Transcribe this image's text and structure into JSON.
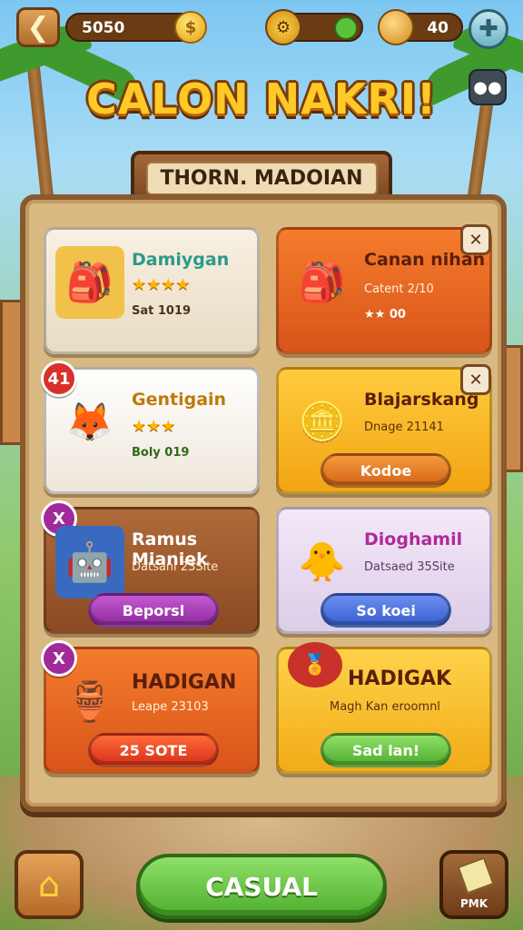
{
  "topbar": {
    "coins": "5050",
    "gems": "40",
    "back_icon": "back-arrow-icon",
    "settings_icon": "settings-gear-icon",
    "chat_icon": "chat-icon"
  },
  "title": "CALON NAKRI!",
  "subtitle": "THORN. MADOIAN",
  "cards": [
    {
      "name": "Damiygan",
      "stars": "★★★★",
      "meta": "Sat 1019",
      "color": "#2a9a8a"
    },
    {
      "name": "Canan nihan",
      "meta": "Catent 2/10",
      "stars": "★★ 00",
      "color": "#5a1f08"
    },
    {
      "name": "Gentigain",
      "stars": "★★★",
      "meta": "Boly 019",
      "badge": "41",
      "color": "#2d8a3a"
    },
    {
      "name": "Blajarskang",
      "meta": "Dnage 21141",
      "button": "Kodoe",
      "color": "#5a1f08"
    },
    {
      "name": "Ramus Mianiek",
      "meta": "Datsani 23Site",
      "button": "Beporsl",
      "badge": "X",
      "color": "#ffffff"
    },
    {
      "name": "Dioghamil",
      "meta": "Datsaed 35Site",
      "button": "So koei",
      "color": "#b02a9a"
    },
    {
      "name": "HADIGAN",
      "meta": "Leape 23103",
      "button": "25 SOTE",
      "badge": "X",
      "color": "#5a1f08"
    },
    {
      "name": "HADIGAK",
      "meta": "Magh Kan eroomnl",
      "button": "Sad lan!",
      "color": "#5a1f08"
    }
  ],
  "bottom": {
    "main_button": "CASUAL",
    "shop_label": "PMK"
  }
}
